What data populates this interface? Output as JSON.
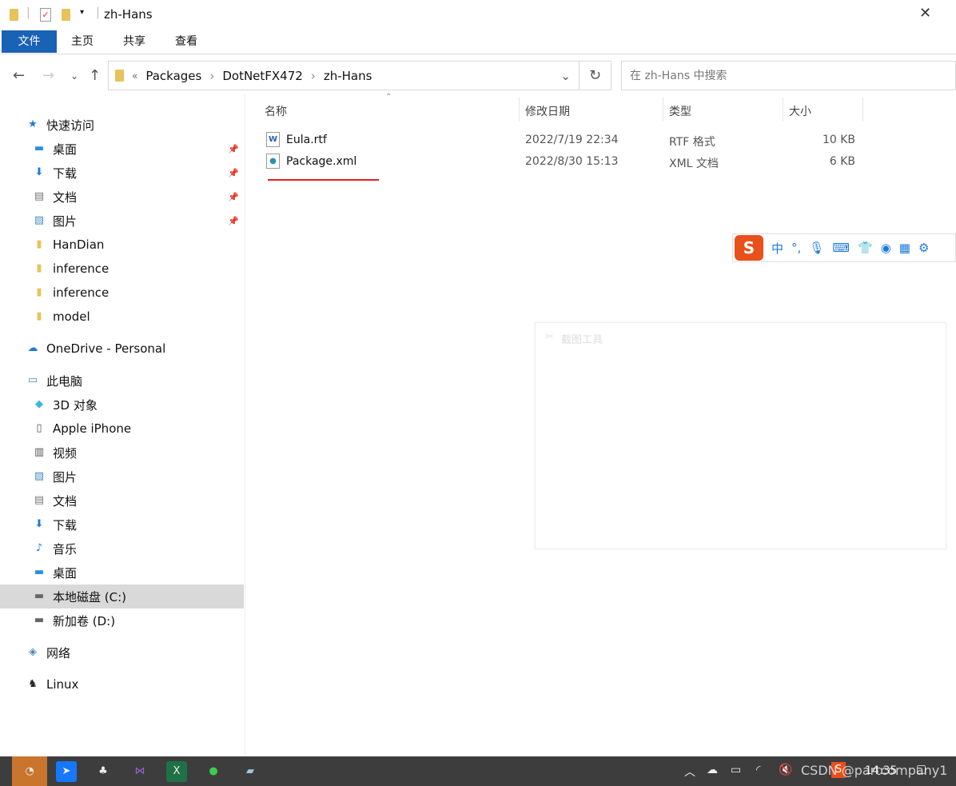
{
  "window": {
    "title": "zh-Hans"
  },
  "ribbon": {
    "tabs": [
      "文件",
      "主页",
      "共享",
      "查看"
    ]
  },
  "address": {
    "overflow": "«",
    "crumbs": [
      "Packages",
      "DotNetFX472",
      "zh-Hans"
    ],
    "search_placeholder": "在 zh-Hans 中搜索"
  },
  "sidebar": {
    "items": [
      {
        "label": "快速访问",
        "icon": "star-icon",
        "color": "#1e7bd8"
      },
      {
        "label": "桌面",
        "icon": "desktop-icon",
        "color": "#2a8fe0",
        "pin": true
      },
      {
        "label": "下载",
        "icon": "download-icon",
        "color": "#1e7bd8",
        "pin": true
      },
      {
        "label": "文档",
        "icon": "document-icon",
        "color": "#777",
        "pin": true
      },
      {
        "label": "图片",
        "icon": "pictures-icon",
        "color": "#4a8bc0",
        "pin": true
      },
      {
        "label": "HanDian",
        "icon": "folder-icon",
        "color": "#e8c25a"
      },
      {
        "label": "inference",
        "icon": "folder-icon",
        "color": "#e8c25a"
      },
      {
        "label": "inference",
        "icon": "folder-icon",
        "color": "#e8c25a"
      },
      {
        "label": "model",
        "icon": "folder-icon",
        "color": "#e8c25a"
      },
      {
        "label": "OneDrive - Personal",
        "icon": "cloud-icon",
        "color": "#1e7bd8"
      },
      {
        "label": "此电脑",
        "icon": "computer-icon",
        "color": "#4a8bc0"
      },
      {
        "label": "3D 对象",
        "icon": "cube-icon",
        "color": "#3cb6d8"
      },
      {
        "label": "Apple iPhone",
        "icon": "phone-icon",
        "color": "#555"
      },
      {
        "label": "视频",
        "icon": "video-icon",
        "color": "#555"
      },
      {
        "label": "图片",
        "icon": "pictures-icon",
        "color": "#4a8bc0"
      },
      {
        "label": "文档",
        "icon": "document-icon",
        "color": "#777"
      },
      {
        "label": "下载",
        "icon": "download-icon",
        "color": "#1e7bd8"
      },
      {
        "label": "音乐",
        "icon": "music-icon",
        "color": "#1e7bd8"
      },
      {
        "label": "桌面",
        "icon": "desktop-icon",
        "color": "#2a8fe0"
      },
      {
        "label": "本地磁盘 (C:)",
        "icon": "drive-icon",
        "color": "#666",
        "selected": true
      },
      {
        "label": "新加卷 (D:)",
        "icon": "drive-icon",
        "color": "#666"
      },
      {
        "label": "网络",
        "icon": "network-icon",
        "color": "#4a8bc0"
      },
      {
        "label": "Linux",
        "icon": "linux-icon",
        "color": "#222"
      }
    ]
  },
  "columns": [
    "名称",
    "修改日期",
    "类型",
    "大小"
  ],
  "files": [
    {
      "name": "Eula.rtf",
      "date": "2022/7/19 22:34",
      "type": "RTF 格式",
      "size": "10 KB",
      "icon": "word-file-icon"
    },
    {
      "name": "Package.xml",
      "date": "2022/8/30 15:13",
      "type": "XML 文档",
      "size": "6 KB",
      "icon": "xml-file-icon"
    }
  ],
  "ime": {
    "mode": "中",
    "punct": "°,"
  },
  "panel": {
    "title": "截图工具"
  },
  "taskbar": {
    "time": "14:35",
    "watermark": "CSDN @partcompany1"
  }
}
